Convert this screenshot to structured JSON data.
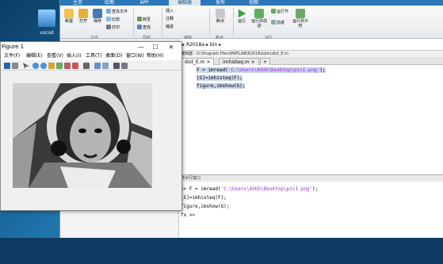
{
  "desktop": {
    "icon_label": "vscod"
  },
  "matlab": {
    "tabs": [
      "主页",
      "绘图",
      "APP",
      "编辑器",
      "发布",
      "视图"
    ],
    "ribbon": {
      "new": "新建",
      "open": "打开",
      "save": "保存",
      "find_files": "查找文件",
      "compare": "比较",
      "print": "打印",
      "insert": "插入",
      "comment": "注释",
      "indent": "缩进",
      "goto": "转至",
      "find": "查找",
      "breakpoint": "断点",
      "run": "运行",
      "run_advance": "运行并前进",
      "advance": "前进",
      "run_section": "运行节",
      "run_time": "运行并计时",
      "groups": [
        "文件",
        "导航",
        "编辑",
        "断点",
        "运行"
      ]
    },
    "address": {
      "path": "R2018a",
      "sub": "bin"
    },
    "editor": {
      "path": "编辑器 - D:\\Program Files\\MATLAB\\R2018a\\bin\\dist_E.m",
      "tabs": [
        "dist_E.m",
        "imhisteq.m"
      ],
      "add_tab": "+",
      "lines": [
        {
          "pre": "F = imread(",
          "str": "'C:\\Users\\ASUS\\Desktop\\pic1.png'",
          "post": ");"
        },
        {
          "pre": "[G]=imhisteq(F);",
          "str": "",
          "post": ""
        },
        {
          "pre": "figure,imshow(G);",
          "str": "",
          "post": ""
        }
      ]
    },
    "command": {
      "title": "命令行窗口",
      "lines": [
        {
          "pre": ">> F = imread(",
          "str": "'C:\\Users\\ASUS\\Desktop\\pic1.png'",
          "post": ");"
        },
        {
          "pre": "[G]=imhisteq(F);",
          "str": "",
          "post": ""
        },
        {
          "pre": "figure,imshow(G);",
          "str": "",
          "post": ""
        },
        {
          "pre": "fx >>",
          "str": "",
          "post": ""
        }
      ]
    }
  },
  "figure": {
    "title": "Figure 1",
    "menu": [
      "文件(F)",
      "编辑(E)",
      "查看(V)",
      "插入(I)",
      "工具(T)",
      "桌面(D)",
      "窗口(W)",
      "帮助(H)"
    ],
    "controls": {
      "minimize": "—",
      "maximize": "☐",
      "close": "✕"
    }
  },
  "colors": {
    "matlab_tab_bar": "#2c77b8",
    "desktop": "#1c6ea4",
    "string": "#a020f0",
    "highlight": "#c9d7ea"
  }
}
